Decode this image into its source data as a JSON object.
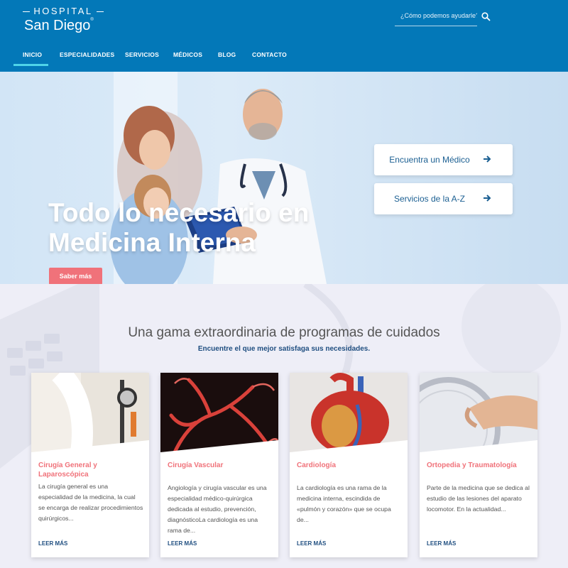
{
  "brand": {
    "top": "HOSPITAL",
    "bottom": "San Diego",
    "reg": "®"
  },
  "search": {
    "placeholder": "¿Cómo podemos ayudarle?"
  },
  "nav": {
    "items": [
      {
        "label": "INICIO"
      },
      {
        "label": "ESPECIALIDADES"
      },
      {
        "label": "SERVICIOS"
      },
      {
        "label": "MÉDICOS"
      },
      {
        "label": "BLOG"
      },
      {
        "label": "CONTACTO"
      }
    ]
  },
  "hero": {
    "title": "Todo lo necesario en Medicina Interna",
    "button": "Saber más",
    "cta": [
      {
        "label": "Encuentra un Médico"
      },
      {
        "label": "Servicios de la A-Z"
      }
    ]
  },
  "programs": {
    "title": "Una gama extraordinaria de programas de cuidados",
    "subtitle": "Encuentre el que mejor satisfaga sus necesidades.",
    "cards": [
      {
        "title": "Cirugía General y Laparoscópica",
        "desc": "La cirugía general es una especialidad de la medicina, la cual se encarga de realizar procedimientos quirúrgicos...",
        "link": "LEER MÁS"
      },
      {
        "title": "Cirugía Vascular",
        "desc": "Angiología y cirugía vascular es una especialidad médico-quirúrgica dedicada al estudio, prevención, diagnósticoLa cardiología es una rama de...",
        "link": "LEER MÁS"
      },
      {
        "title": "Cardiología",
        "desc": "La cardiología es una rama de la medicina interna, escindida de «pulmón y corazón» que se ocupa de...",
        "link": "LEER MÁS"
      },
      {
        "title": "Ortopedia y Traumatología",
        "desc": "Parte de la medicina que se dedica al estudio de las lesiones del aparato locomotor. En la actualidad...",
        "link": "LEER MÁS"
      }
    ]
  },
  "colors": {
    "header": "#0378b8",
    "accent": "#f0727a",
    "navActive": "#4fd4e8",
    "link": "#1f4e80"
  }
}
